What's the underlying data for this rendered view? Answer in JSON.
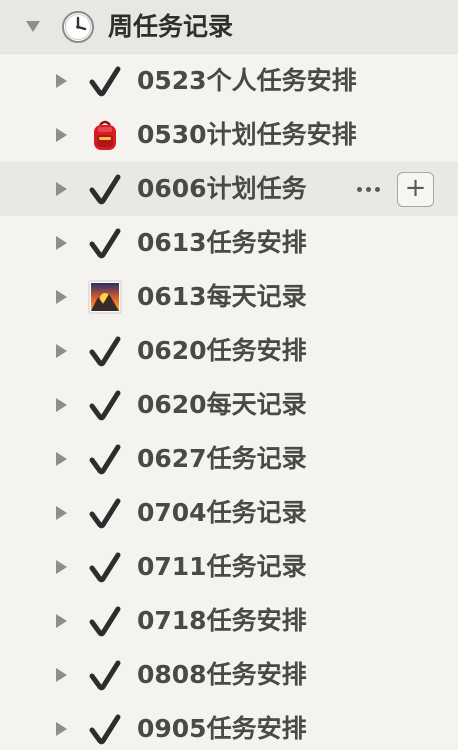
{
  "parent": {
    "icon": "clock-icon",
    "label": "周任务记录"
  },
  "actions": {
    "more_icon": "ellipsis-icon",
    "add_label": "+"
  },
  "items": [
    {
      "icon": "checkmark-icon",
      "label": "0523个人任务安排"
    },
    {
      "icon": "backpack-icon",
      "label": "0530计划任务安排"
    },
    {
      "icon": "checkmark-icon",
      "label": "0606计划任务"
    },
    {
      "icon": "checkmark-icon",
      "label": "0613任务安排"
    },
    {
      "icon": "sunrise-mountain-icon",
      "label": "0613每天记录"
    },
    {
      "icon": "checkmark-icon",
      "label": "0620任务安排"
    },
    {
      "icon": "checkmark-icon",
      "label": "0620每天记录"
    },
    {
      "icon": "checkmark-icon",
      "label": "0627任务记录"
    },
    {
      "icon": "checkmark-icon",
      "label": "0704任务记录"
    },
    {
      "icon": "checkmark-icon",
      "label": "0711任务记录"
    },
    {
      "icon": "checkmark-icon",
      "label": "0718任务安排"
    },
    {
      "icon": "checkmark-icon",
      "label": "0808任务安排"
    },
    {
      "icon": "checkmark-icon",
      "label": "0905任务安排"
    }
  ]
}
